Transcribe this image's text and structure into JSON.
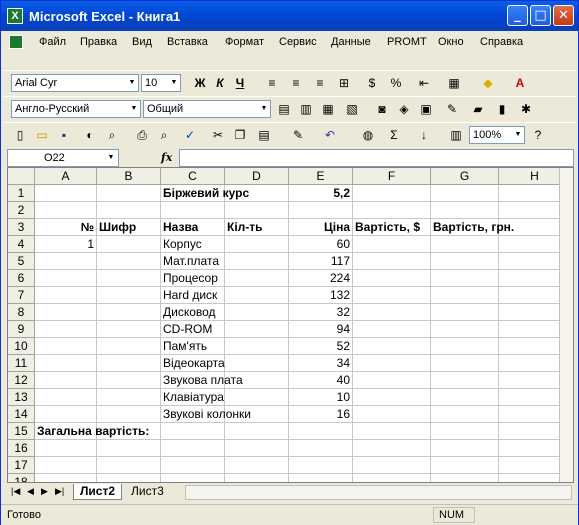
{
  "window": {
    "title": "Microsoft Excel - Книга1",
    "minimize": "_",
    "maximize": "□",
    "close": "✕"
  },
  "menu": [
    "Файл",
    "Правка",
    "Вид",
    "Вставка",
    "Формат",
    "Сервис",
    "Данные",
    "PROMT",
    "Окно",
    "Справка"
  ],
  "toolbar_format": {
    "font_name": "Arial Cyr",
    "font_size": "10",
    "bold": "Ж",
    "italic": "К",
    "underline": "Ч"
  },
  "toolbar_promt": {
    "direction": "Англо-Русский",
    "subject": "Общий"
  },
  "toolbar_standard": {
    "zoom": "100%",
    "sigma": "Σ"
  },
  "formula_bar": {
    "cell_ref": "O22",
    "fx": "fx",
    "content": ""
  },
  "columns": [
    "A",
    "B",
    "C",
    "D",
    "E",
    "F",
    "G",
    "H"
  ],
  "rows": [
    {
      "n": "1",
      "cells": [
        "",
        "",
        "Біржевий курс",
        "",
        "5,2",
        "",
        "",
        ""
      ]
    },
    {
      "n": "2",
      "cells": [
        "",
        "",
        "",
        "",
        "",
        "",
        "",
        ""
      ]
    },
    {
      "n": "3",
      "cells": [
        "№",
        "Шифр",
        "Назва",
        "Кіл-ть",
        "Ціна",
        "Вартість, $",
        "Вартість, грн.",
        ""
      ]
    },
    {
      "n": "4",
      "cells": [
        "1",
        "",
        "Корпус",
        "",
        "60",
        "",
        "",
        ""
      ]
    },
    {
      "n": "5",
      "cells": [
        "",
        "",
        "Мат.плата",
        "",
        "117",
        "",
        "",
        ""
      ]
    },
    {
      "n": "6",
      "cells": [
        "",
        "",
        "Процесор",
        "",
        "224",
        "",
        "",
        ""
      ]
    },
    {
      "n": "7",
      "cells": [
        "",
        "",
        "Hard диск",
        "",
        "132",
        "",
        "",
        ""
      ]
    },
    {
      "n": "8",
      "cells": [
        "",
        "",
        "Дисковод",
        "",
        "32",
        "",
        "",
        ""
      ]
    },
    {
      "n": "9",
      "cells": [
        "",
        "",
        "CD-ROM",
        "",
        "94",
        "",
        "",
        ""
      ]
    },
    {
      "n": "10",
      "cells": [
        "",
        "",
        "Пам'ять",
        "",
        "52",
        "",
        "",
        ""
      ]
    },
    {
      "n": "11",
      "cells": [
        "",
        "",
        "Відеокарта",
        "",
        "34",
        "",
        "",
        ""
      ]
    },
    {
      "n": "12",
      "cells": [
        "",
        "",
        "Звукова плата",
        "",
        "40",
        "",
        "",
        ""
      ]
    },
    {
      "n": "13",
      "cells": [
        "",
        "",
        "Клавіатура",
        "",
        "10",
        "",
        "",
        ""
      ]
    },
    {
      "n": "14",
      "cells": [
        "",
        "",
        "Звукові колонки",
        "",
        "16",
        "",
        "",
        ""
      ]
    },
    {
      "n": "15",
      "cells": [
        "Загальна вартість:",
        "",
        "",
        "",
        "",
        "",
        "",
        ""
      ]
    },
    {
      "n": "16",
      "cells": [
        "",
        "",
        "",
        "",
        "",
        "",
        "",
        ""
      ]
    },
    {
      "n": "17",
      "cells": [
        "",
        "",
        "",
        "",
        "",
        "",
        "",
        ""
      ]
    },
    {
      "n": "18",
      "cells": [
        "",
        "",
        "",
        "",
        "",
        "",
        "",
        ""
      ]
    }
  ],
  "sheets": [
    "Лист2",
    "Лист3"
  ],
  "active_sheet": "Лист2",
  "status": {
    "left": "Готово",
    "num": "NUM"
  }
}
